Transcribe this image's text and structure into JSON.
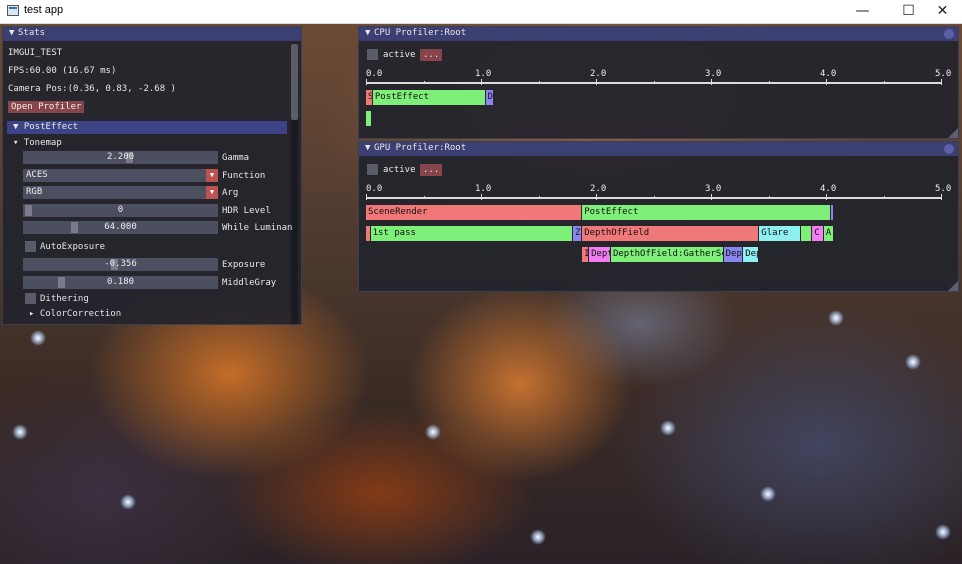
{
  "window": {
    "title": "test app",
    "minimize": "—",
    "maximize": "☐",
    "close": "✕"
  },
  "stats": {
    "title": "Stats",
    "app_name": "IMGUI_TEST",
    "fps": "FPS:60.00 (16.67 ms)",
    "camera": "Camera Pos:(0.36, 0.83, -2.68 )",
    "open_profiler": "Open Profiler",
    "posteffect_header": "PostEffect",
    "tonemap_node": "Tonemap",
    "rows": [
      {
        "value": "2.200",
        "label": "Gamma",
        "kind": "slider",
        "fraction": 0.55
      },
      {
        "value": "ACES",
        "label": "Function",
        "kind": "combo"
      },
      {
        "value": "RGB",
        "label": "Arg",
        "kind": "combo"
      },
      {
        "value": "0",
        "label": "HDR Level",
        "kind": "slider",
        "fraction": 0.0
      },
      {
        "value": "64.000",
        "label": "While Luminan",
        "kind": "slider",
        "fraction": 0.25
      }
    ],
    "autoexposure": "AutoExposure",
    "rows2": [
      {
        "value": "-0.356",
        "label": "Exposure",
        "kind": "slider",
        "fraction": 0.47
      },
      {
        "value": "0.180",
        "label": "MiddleGray",
        "kind": "slider",
        "fraction": 0.18
      }
    ],
    "dithering": "Dithering",
    "colorcorrection": "ColorCorrection"
  },
  "cpu_profiler": {
    "title": "CPU Profiler:Root",
    "active_label": "active",
    "more_button": "...",
    "axis_labels": [
      "0.0",
      "1.0",
      "2.0",
      "3.0",
      "4.0",
      "5.0"
    ],
    "bars": [
      {
        "label": "S",
        "start": 0.0,
        "end": 0.06,
        "row": 0,
        "color": "#f07878"
      },
      {
        "label": "PostEffect",
        "start": 0.06,
        "end": 1.04,
        "row": 0,
        "color": "#7ef07a"
      },
      {
        "label": "D",
        "start": 1.04,
        "end": 1.11,
        "row": 0,
        "color": "#8a86f0"
      },
      {
        "label": "",
        "start": 0.0,
        "end": 0.05,
        "row": 1,
        "color": "#7ef07a"
      }
    ]
  },
  "gpu_profiler": {
    "title": "GPU Profiler:Root",
    "active_label": "active",
    "more_button": "...",
    "axis_labels": [
      "0.0",
      "1.0",
      "2.0",
      "3.0",
      "4.0",
      "5.0"
    ],
    "bars": [
      {
        "label": "SceneRender",
        "start": 0.0,
        "end": 1.88,
        "row": 0,
        "color": "#f07878"
      },
      {
        "label": "PostEffect",
        "start": 1.88,
        "end": 4.04,
        "row": 0,
        "color": "#7ef07a"
      },
      {
        "label": "",
        "start": 4.04,
        "end": 4.07,
        "row": 0,
        "color": "#8a86f0"
      },
      {
        "label": "",
        "start": 0.0,
        "end": 0.04,
        "row": 1,
        "color": "#f07878"
      },
      {
        "label": "1st pass",
        "start": 0.04,
        "end": 1.8,
        "row": 1,
        "color": "#7ef07a"
      },
      {
        "label": "Z",
        "start": 1.8,
        "end": 1.88,
        "row": 1,
        "color": "#8a86f0"
      },
      {
        "label": "DepthOfField",
        "start": 1.88,
        "end": 3.42,
        "row": 1,
        "color": "#f07878"
      },
      {
        "label": "Glare",
        "start": 3.42,
        "end": 3.78,
        "row": 1,
        "color": "#8ef0f0"
      },
      {
        "label": "",
        "start": 3.78,
        "end": 3.88,
        "row": 1,
        "color": "#7ef07a"
      },
      {
        "label": "C",
        "start": 3.88,
        "end": 3.98,
        "row": 1,
        "color": "#f07ef0"
      },
      {
        "label": "A",
        "start": 3.98,
        "end": 4.07,
        "row": 1,
        "color": "#7ef07a"
      },
      {
        "label": "I",
        "start": 1.88,
        "end": 1.94,
        "row": 2,
        "color": "#f07878"
      },
      {
        "label": "Dept",
        "start": 1.94,
        "end": 2.13,
        "row": 2,
        "color": "#f07ef0"
      },
      {
        "label": "DepthOfField:GatherSc",
        "start": 2.13,
        "end": 3.11,
        "row": 2,
        "color": "#7ef07a"
      },
      {
        "label": "Dep",
        "start": 3.11,
        "end": 3.28,
        "row": 2,
        "color": "#8a86f0"
      },
      {
        "label": "Dep",
        "start": 3.28,
        "end": 3.42,
        "row": 2,
        "color": "#8ef0f0"
      }
    ]
  }
}
